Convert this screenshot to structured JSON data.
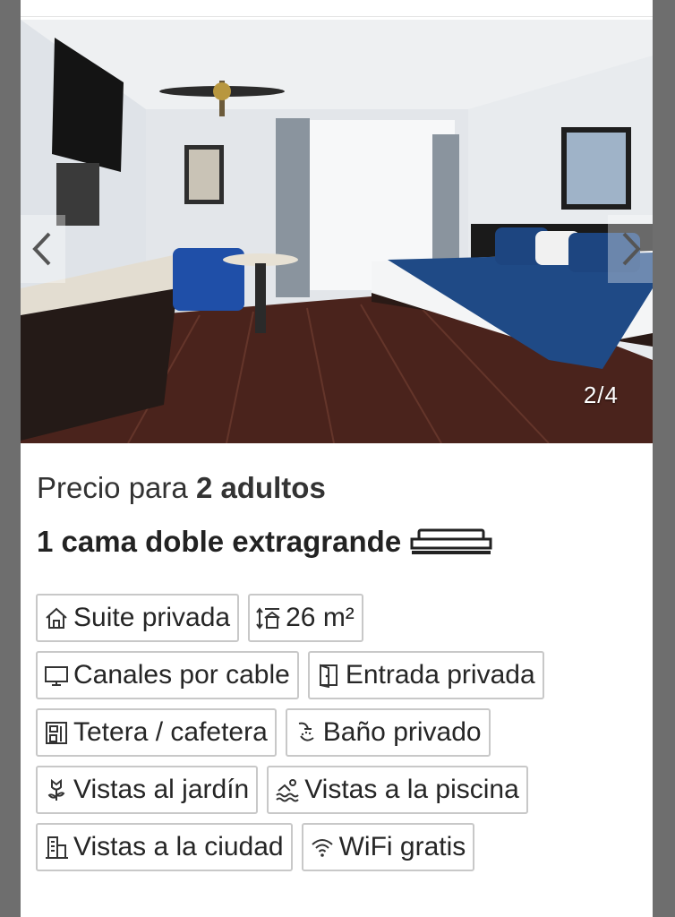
{
  "gallery": {
    "counter": "2/4",
    "prev_icon": "chevron-left-icon",
    "next_icon": "chevron-right-icon"
  },
  "price": {
    "prefix": "Precio para",
    "guests": "2 adultos"
  },
  "bed": {
    "label": "1 cama doble extragrande",
    "icon": "bed-icon"
  },
  "facilities": [
    {
      "label": "Suite privada",
      "icon": "house-icon"
    },
    {
      "label": "26 m²",
      "icon": "room-size-icon"
    },
    {
      "label": "Canales por cable",
      "icon": "tv-icon"
    },
    {
      "label": "Entrada privada",
      "icon": "door-icon"
    },
    {
      "label": "Tetera / cafetera",
      "icon": "coffee-maker-icon"
    },
    {
      "label": "Baño privado",
      "icon": "shower-icon"
    },
    {
      "label": "Vistas al jardín",
      "icon": "flower-icon"
    },
    {
      "label": "Vistas a la piscina",
      "icon": "pool-icon"
    },
    {
      "label": "Vistas a la ciudad",
      "icon": "city-icon"
    },
    {
      "label": "WiFi gratis",
      "icon": "wifi-icon"
    }
  ],
  "colors": {
    "background": "#6e6e6e",
    "card": "#ffffff",
    "text": "#262626",
    "chip_border": "#c8c8c8",
    "bedding_accent": "#1f4a86"
  }
}
